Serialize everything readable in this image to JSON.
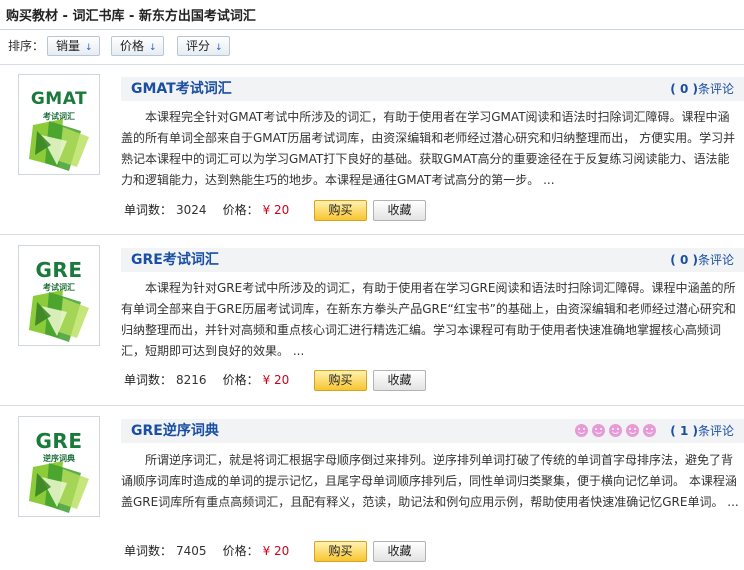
{
  "breadcrumb": "购买教材 - 词汇书库 - 新东方出国考试词汇",
  "sort": {
    "label": "排序：",
    "buttons": [
      {
        "label": "销量",
        "arrow": "↓"
      },
      {
        "label": "价格",
        "arrow": "↓"
      },
      {
        "label": "评分",
        "arrow": "↓"
      }
    ]
  },
  "labels": {
    "word_count": "单词数：",
    "price": "价格：",
    "buy": "购买",
    "favorite": "收藏",
    "comments_suffix": "条评论"
  },
  "products": [
    {
      "title": "GMAT考试词汇",
      "cover_title": "GMAT",
      "cover_subtitle": "考试词汇",
      "comments_count": "( 0 )",
      "rating": 0,
      "description": "本课程完全针对GMAT考试中所涉及的词汇，有助于使用者在学习GMAT阅读和语法时扫除词汇障碍。课程中涵盖的所有单词全部来自于GMAT历届考试词库，由资深编辑和老师经过潜心研究和归纳整理而出， 方便实用。学习并熟记本课程中的词汇可以为学习GMAT打下良好的基础。获取GMAT高分的重要途径在于反复练习阅读能力、语法能力和逻辑能力，达到熟能生巧的地步。本课程是通往GMAT考试高分的第一步。 ...",
      "word_count": "3024",
      "price": "¥ 20"
    },
    {
      "title": "GRE考试词汇",
      "cover_title": "GRE",
      "cover_subtitle": "考试词汇",
      "comments_count": "( 0 )",
      "rating": 0,
      "description": "本课程为针对GRE考试中所涉及的词汇，有助于使用者在学习GRE阅读和语法时扫除词汇障碍。课程中涵盖的所有单词全部来自于GRE历届考试词库，在新东方拳头产品GRE“红宝书”的基础上，由资深编辑和老师经过潜心研究和归纳整理而出，并针对高频和重点核心词汇进行精选汇编。学习本课程可有助于使用者快速准确地掌握核心高频词汇，短期即可达到良好的效果。 ...",
      "word_count": "8216",
      "price": "¥ 20"
    },
    {
      "title": "GRE逆序词典",
      "cover_title": "GRE",
      "cover_subtitle": "逆序词典",
      "comments_count": "( 1 )",
      "rating": 5,
      "description": "所谓逆序词汇，就是将词汇根据字母顺序倒过来排列。逆序排列单词打破了传统的单词首字母排序法，避免了背诵顺序词库时造成的单词的提示记忆，且尾字母单词顺序排列后，同性单词归类聚集，便于横向记忆单词。 本课程涵盖GRE词库所有重点高频词汇，且配有释义，范读，助记法和例句应用示例，帮助使用者快速准确记忆GRE单词。 ...",
      "word_count": "7405",
      "price": "¥ 20"
    }
  ]
}
